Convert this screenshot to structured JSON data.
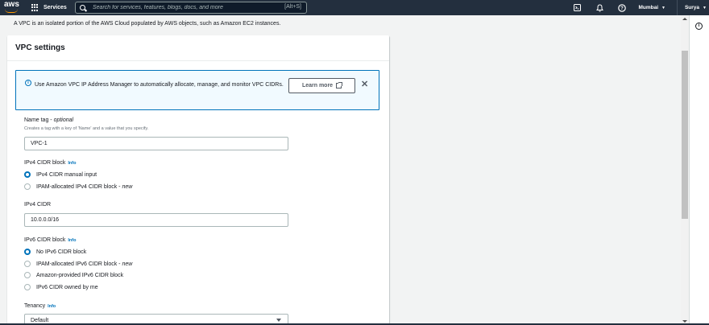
{
  "topbar": {
    "logo_text": "aws",
    "services_label": "Services",
    "search_placeholder": "Search for services, features, blogs, docs, and more",
    "search_shortcut": "[Alt+S]",
    "region_label": "Mumbai",
    "user_label": "Surya",
    "icons": [
      "cloudshell-icon",
      "bell-icon",
      "help-icon"
    ]
  },
  "intro_text": "A VPC is an isolated portion of the AWS Cloud populated by AWS objects, such as Amazon EC2 instances.",
  "vpc_settings": {
    "title": "VPC settings",
    "alert": {
      "text": "Use Amazon VPC IP Address Manager to automatically allocate, manage, and monitor VPC CIDRs.",
      "learn_more_label": "Learn more"
    },
    "name_tag": {
      "label": "Name tag - ",
      "label_optional": "optional",
      "description": "Creates a tag with a key of 'Name' and a value that you specify.",
      "value": "VPC-1"
    },
    "ipv4_cidr_block": {
      "label": "IPv4 CIDR block",
      "info_label": "Info",
      "options": [
        {
          "label": "IPv4 CIDR manual input",
          "suffix": "",
          "selected": true
        },
        {
          "label": "IPAM-allocated IPv4 CIDR block - ",
          "suffix": "new",
          "selected": false
        }
      ]
    },
    "ipv4_cidr": {
      "label": "IPv4 CIDR",
      "value": "10.0.0.0/16"
    },
    "ipv6_cidr_block": {
      "label": "IPv6 CIDR block",
      "info_label": "Info",
      "options": [
        {
          "label": "No IPv6 CIDR block",
          "suffix": "",
          "selected": true
        },
        {
          "label": "IPAM-allocated IPv6 CIDR block - ",
          "suffix": "new",
          "selected": false
        },
        {
          "label": "Amazon-provided IPv6 CIDR block",
          "suffix": "",
          "selected": false
        },
        {
          "label": "IPv6 CIDR owned by me",
          "suffix": "",
          "selected": false
        }
      ]
    },
    "tenancy": {
      "label": "Tenancy",
      "info_label": "Info",
      "value": "Default"
    }
  },
  "colors": {
    "topbar_bg": "#232f3e",
    "accent_blue": "#0073bb",
    "aws_orange": "#ff9900",
    "page_bg": "#f2f3f3"
  }
}
